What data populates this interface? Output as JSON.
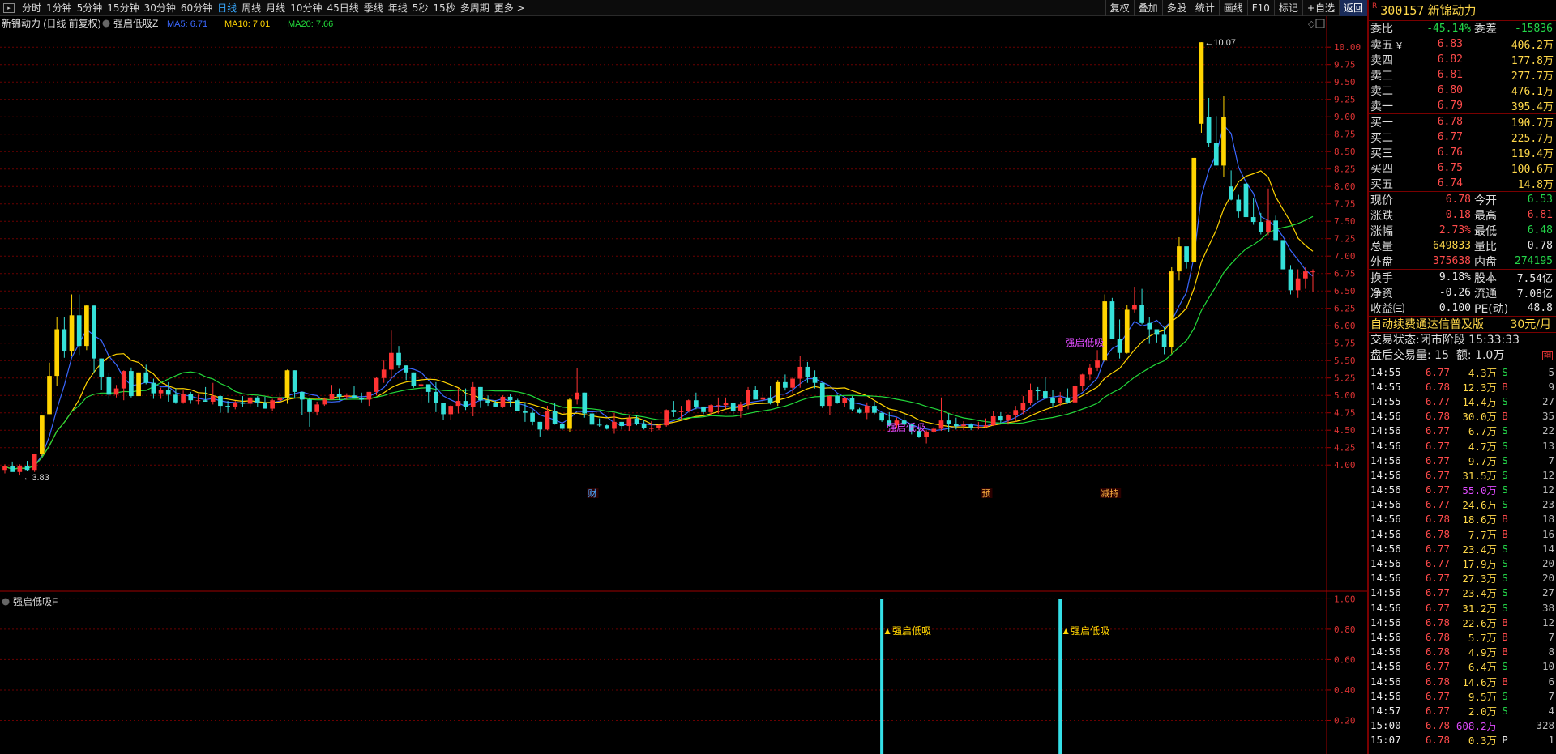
{
  "toolbar": {
    "periods": [
      "分时",
      "1分钟",
      "5分钟",
      "15分钟",
      "30分钟",
      "60分钟",
      "日线",
      "周线",
      "月线",
      "10分钟",
      "45日线",
      "季线",
      "年线",
      "5秒",
      "15秒",
      "多周期",
      "更多 >"
    ],
    "active": "日线",
    "actions": [
      "复权",
      "叠加",
      "多股",
      "统计",
      "画线",
      "F10",
      "标记",
      "+自选",
      "返回"
    ]
  },
  "chart_data": {
    "type": "candlestick",
    "title": "新锦动力 (日线 前复权)",
    "indicator": "强启低吸Z",
    "ma_labels": [
      "MA5: 6.71",
      "MA10: 7.01",
      "MA20: 7.66"
    ],
    "ma_colors": [
      "#3b68ff",
      "#ffd400",
      "#22d83a"
    ],
    "ylim": [
      3.7,
      10.2
    ],
    "yticks": [
      10.0,
      9.75,
      9.5,
      9.25,
      9.0,
      8.75,
      8.5,
      8.25,
      8.0,
      7.75,
      7.5,
      7.25,
      7.0,
      6.75,
      6.5,
      6.25,
      6.0,
      5.75,
      5.5,
      5.25,
      5.0,
      4.75,
      4.5,
      4.25,
      4.0
    ],
    "max_label": "10.07",
    "min_label": "3.83",
    "event_markers": [
      {
        "label": "财",
        "idx": 79
      },
      {
        "label": "预",
        "idx": 132
      },
      {
        "label": "减持",
        "idx": 148
      }
    ],
    "signal_labels": [
      {
        "text": "强启低吸",
        "idx": 142,
        "price": 5.76
      },
      {
        "text": "强启低吸",
        "idx": 118,
        "price": 4.54
      }
    ],
    "candles": [
      [
        3.93,
        4.01,
        3.88,
        3.98
      ],
      [
        3.98,
        4.05,
        3.92,
        3.9
      ],
      [
        3.9,
        4.01,
        3.85,
        3.99
      ],
      [
        3.99,
        4.06,
        3.91,
        3.93
      ],
      [
        3.93,
        4.16,
        3.9,
        4.16
      ],
      [
        4.16,
        4.71,
        4.13,
        4.71
      ],
      [
        4.73,
        5.47,
        4.73,
        5.28
      ],
      [
        5.28,
        6.12,
        5.13,
        5.95
      ],
      [
        5.95,
        6.12,
        5.54,
        5.63
      ],
      [
        5.63,
        6.45,
        5.57,
        6.15
      ],
      [
        6.15,
        6.45,
        5.58,
        5.71
      ],
      [
        5.71,
        6.3,
        5.65,
        6.29
      ],
      [
        6.29,
        6.29,
        5.33,
        5.53
      ],
      [
        5.53,
        5.53,
        5.08,
        5.27
      ],
      [
        5.27,
        5.32,
        4.95,
        5.01
      ],
      [
        5.01,
        5.15,
        4.97,
        5.1
      ],
      [
        5.1,
        5.36,
        4.93,
        5.35
      ],
      [
        5.35,
        5.4,
        4.97,
        4.99
      ],
      [
        4.99,
        5.33,
        4.99,
        5.33
      ],
      [
        5.33,
        5.44,
        5.16,
        5.18
      ],
      [
        5.18,
        5.24,
        4.95,
        5.03
      ],
      [
        5.03,
        5.11,
        4.95,
        5.08
      ],
      [
        5.08,
        5.19,
        4.91,
        5.01
      ],
      [
        5.01,
        5.1,
        4.88,
        4.9
      ],
      [
        4.9,
        5.07,
        4.88,
        5.02
      ],
      [
        5.02,
        5.05,
        4.88,
        4.93
      ],
      [
        4.93,
        5.01,
        4.87,
        4.93
      ],
      [
        4.93,
        5.12,
        4.91,
        4.91
      ],
      [
        4.91,
        5.18,
        4.87,
        4.99
      ],
      [
        4.99,
        5.0,
        4.75,
        4.85
      ],
      [
        4.85,
        4.92,
        4.75,
        4.84
      ],
      [
        4.84,
        4.92,
        4.8,
        4.9
      ],
      [
        4.9,
        4.99,
        4.84,
        4.88
      ],
      [
        4.88,
        4.98,
        4.84,
        4.97
      ],
      [
        4.97,
        4.99,
        4.84,
        4.9
      ],
      [
        4.9,
        4.98,
        4.81,
        4.81
      ],
      [
        4.81,
        4.95,
        4.77,
        4.93
      ],
      [
        4.93,
        5.04,
        4.89,
        4.97
      ],
      [
        4.97,
        5.37,
        4.88,
        5.36
      ],
      [
        5.36,
        5.36,
        4.97,
        5.05
      ],
      [
        5.05,
        5.05,
        4.72,
        4.94
      ],
      [
        4.94,
        4.97,
        4.55,
        4.76
      ],
      [
        4.76,
        4.91,
        4.71,
        4.87
      ],
      [
        4.87,
        4.97,
        4.85,
        4.94
      ],
      [
        4.94,
        5.15,
        4.94,
        5.02
      ],
      [
        5.02,
        5.1,
        4.93,
        4.98
      ],
      [
        4.98,
        5.03,
        4.94,
        5.0
      ],
      [
        5.0,
        5.13,
        4.96,
        4.96
      ],
      [
        4.96,
        5.04,
        4.9,
        4.94
      ],
      [
        4.94,
        5.05,
        4.85,
        5.05
      ],
      [
        5.05,
        5.26,
        5.0,
        5.25
      ],
      [
        5.25,
        5.5,
        5.18,
        5.37
      ],
      [
        5.37,
        5.93,
        5.24,
        5.61
      ],
      [
        5.61,
        5.71,
        5.39,
        5.43
      ],
      [
        5.43,
        5.43,
        5.22,
        5.33
      ],
      [
        5.33,
        5.33,
        5.11,
        5.13
      ],
      [
        5.13,
        5.2,
        4.88,
        5.16
      ],
      [
        5.16,
        5.16,
        4.9,
        5.05
      ],
      [
        5.05,
        5.19,
        4.76,
        4.89
      ],
      [
        4.89,
        4.89,
        4.65,
        4.73
      ],
      [
        4.73,
        4.86,
        4.65,
        4.85
      ],
      [
        4.85,
        5.1,
        4.74,
        4.92
      ],
      [
        4.92,
        5.1,
        4.79,
        4.83
      ],
      [
        4.83,
        5.19,
        4.7,
        5.12
      ],
      [
        5.12,
        5.12,
        4.82,
        4.93
      ],
      [
        4.93,
        5.0,
        4.85,
        4.89
      ],
      [
        4.89,
        4.93,
        4.84,
        4.84
      ],
      [
        4.84,
        5.0,
        4.82,
        4.98
      ],
      [
        4.98,
        5.02,
        4.83,
        4.93
      ],
      [
        4.93,
        4.95,
        4.77,
        4.78
      ],
      [
        4.78,
        4.89,
        4.62,
        4.75
      ],
      [
        4.75,
        4.79,
        4.57,
        4.62
      ],
      [
        4.62,
        4.62,
        4.41,
        4.51
      ],
      [
        4.51,
        4.85,
        4.5,
        4.77
      ],
      [
        4.77,
        4.89,
        4.58,
        4.59
      ],
      [
        4.59,
        4.59,
        4.5,
        4.52
      ],
      [
        4.52,
        4.96,
        4.47,
        4.94
      ],
      [
        4.94,
        5.39,
        4.87,
        5.04
      ],
      [
        5.04,
        5.04,
        4.68,
        4.74
      ],
      [
        4.74,
        4.74,
        4.56,
        4.58
      ],
      [
        4.58,
        4.67,
        4.55,
        4.57
      ],
      [
        4.57,
        4.58,
        4.51,
        4.52
      ],
      [
        4.52,
        4.75,
        4.45,
        4.62
      ],
      [
        4.62,
        4.62,
        4.51,
        4.56
      ],
      [
        4.56,
        4.71,
        4.49,
        4.67
      ],
      [
        4.67,
        4.71,
        4.57,
        4.59
      ],
      [
        4.59,
        4.64,
        4.51,
        4.53
      ],
      [
        4.53,
        4.63,
        4.47,
        4.53
      ],
      [
        4.53,
        4.58,
        4.5,
        4.57
      ],
      [
        4.57,
        4.8,
        4.55,
        4.79
      ],
      [
        4.79,
        4.92,
        4.69,
        4.76
      ],
      [
        4.76,
        4.85,
        4.64,
        4.78
      ],
      [
        4.78,
        4.94,
        4.76,
        4.93
      ],
      [
        4.93,
        5.04,
        4.8,
        4.84
      ],
      [
        4.84,
        4.84,
        4.73,
        4.76
      ],
      [
        4.76,
        4.87,
        4.73,
        4.86
      ],
      [
        4.86,
        4.97,
        4.74,
        4.86
      ],
      [
        4.86,
        4.97,
        4.81,
        4.89
      ],
      [
        4.89,
        4.89,
        4.73,
        4.78
      ],
      [
        4.78,
        4.91,
        4.68,
        4.87
      ],
      [
        4.87,
        5.12,
        4.8,
        5.08
      ],
      [
        5.08,
        5.13,
        4.94,
        4.94
      ],
      [
        4.94,
        5.05,
        4.89,
        4.97
      ],
      [
        4.97,
        5.14,
        4.87,
        4.89
      ],
      [
        4.89,
        5.22,
        4.85,
        5.19
      ],
      [
        5.19,
        5.3,
        5.07,
        5.11
      ],
      [
        5.11,
        5.27,
        5.03,
        5.24
      ],
      [
        5.24,
        5.57,
        5.11,
        5.41
      ],
      [
        5.41,
        5.48,
        5.18,
        5.26
      ],
      [
        5.26,
        5.36,
        5.1,
        5.18
      ],
      [
        5.18,
        5.18,
        4.82,
        4.85
      ],
      [
        4.85,
        5.0,
        4.72,
        4.99
      ],
      [
        4.99,
        5.01,
        4.88,
        4.89
      ],
      [
        4.89,
        4.97,
        4.83,
        4.96
      ],
      [
        4.96,
        4.99,
        4.78,
        4.8
      ],
      [
        4.8,
        4.82,
        4.74,
        4.75
      ],
      [
        4.75,
        4.9,
        4.66,
        4.85
      ],
      [
        4.85,
        4.91,
        4.73,
        4.75
      ],
      [
        4.75,
        4.75,
        4.62,
        4.64
      ],
      [
        4.64,
        4.76,
        4.55,
        4.57
      ],
      [
        4.57,
        4.68,
        4.53,
        4.64
      ],
      [
        4.64,
        4.74,
        4.55,
        4.58
      ],
      [
        4.58,
        4.6,
        4.44,
        4.49
      ],
      [
        4.49,
        4.53,
        4.39,
        4.4
      ],
      [
        4.4,
        4.5,
        4.31,
        4.48
      ],
      [
        4.48,
        4.55,
        4.46,
        4.52
      ],
      [
        4.52,
        4.97,
        4.49,
        4.64
      ],
      [
        4.64,
        4.74,
        4.47,
        4.59
      ],
      [
        4.59,
        4.68,
        4.51,
        4.56
      ],
      [
        4.56,
        4.63,
        4.5,
        4.58
      ],
      [
        4.58,
        4.6,
        4.5,
        4.54
      ],
      [
        4.54,
        4.62,
        4.51,
        4.55
      ],
      [
        4.55,
        4.67,
        4.54,
        4.57
      ],
      [
        4.57,
        4.77,
        4.56,
        4.7
      ],
      [
        4.7,
        4.76,
        4.6,
        4.64
      ],
      [
        4.64,
        4.73,
        4.58,
        4.72
      ],
      [
        4.72,
        4.85,
        4.62,
        4.79
      ],
      [
        4.79,
        4.99,
        4.73,
        4.89
      ],
      [
        4.89,
        5.17,
        4.86,
        5.08
      ],
      [
        5.08,
        5.12,
        4.93,
        5.06
      ],
      [
        5.06,
        5.27,
        4.95,
        4.96
      ],
      [
        4.96,
        5.08,
        4.84,
        4.89
      ],
      [
        4.89,
        5.05,
        4.85,
        4.97
      ],
      [
        4.97,
        5.1,
        4.88,
        4.9
      ],
      [
        4.9,
        5.17,
        4.89,
        5.14
      ],
      [
        5.14,
        5.31,
        5.06,
        5.3
      ],
      [
        5.3,
        5.45,
        5.22,
        5.4
      ],
      [
        5.4,
        5.65,
        5.35,
        5.5
      ],
      [
        5.5,
        6.45,
        5.48,
        6.35
      ],
      [
        6.35,
        6.4,
        5.82,
        5.81
      ],
      [
        5.81,
        6.09,
        5.53,
        5.61
      ],
      [
        5.61,
        6.3,
        5.6,
        6.23
      ],
      [
        6.23,
        6.56,
        6.19,
        6.3
      ],
      [
        6.3,
        6.53,
        6.02,
        6.04
      ],
      [
        6.04,
        6.13,
        5.74,
        5.95
      ],
      [
        5.95,
        5.95,
        5.76,
        5.87
      ],
      [
        5.87,
        5.98,
        5.59,
        5.69
      ],
      [
        5.69,
        6.84,
        5.6,
        6.78
      ],
      [
        6.78,
        7.27,
        6.65,
        7.14
      ],
      [
        7.14,
        7.07,
        6.82,
        6.92
      ],
      [
        6.92,
        8.41,
        6.93,
        8.41
      ],
      [
        8.9,
        10.07,
        8.77,
        10.07
      ],
      [
        9.0,
        9.27,
        8.57,
        8.62
      ],
      [
        8.62,
        9.01,
        8.45,
        8.3
      ],
      [
        8.3,
        9.3,
        8.13,
        9.0
      ],
      [
        8.0,
        8.23,
        7.8,
        7.81
      ],
      [
        7.81,
        7.88,
        7.55,
        7.64
      ],
      [
        8.04,
        8.04,
        7.54,
        7.56
      ],
      [
        7.56,
        7.83,
        7.45,
        7.49
      ],
      [
        7.49,
        7.62,
        7.31,
        7.34
      ],
      [
        7.34,
        7.97,
        7.3,
        7.51
      ],
      [
        7.51,
        7.58,
        7.26,
        7.23
      ],
      [
        7.23,
        7.22,
        6.81,
        6.81
      ],
      [
        6.81,
        6.87,
        6.45,
        6.51
      ],
      [
        6.51,
        6.81,
        6.4,
        6.68
      ],
      [
        6.68,
        6.84,
        6.53,
        6.78
      ],
      [
        6.78,
        6.81,
        6.48,
        6.78
      ]
    ],
    "ma5_end": 6.71,
    "ma10_end": 7.01,
    "ma20_end": 7.66,
    "sub_indicator": {
      "name": "强启低吸F",
      "yticks": [
        1.0,
        0.8,
        0.6,
        0.4,
        0.2
      ],
      "ylim": [
        0,
        1.05
      ],
      "signals": [
        {
          "idx": 118,
          "value": 1.0,
          "label": "▲强启低吸"
        },
        {
          "idx": 142,
          "value": 1.0,
          "label": "▲强启低吸"
        }
      ]
    }
  },
  "sidebar": {
    "code": "300157",
    "name": "新锦动力",
    "right_mark": "R",
    "webi": {
      "l1": "委比",
      "v1": "-45.14%",
      "l2": "委差",
      "v2": "-15836"
    },
    "sells": [
      {
        "label": "卖五",
        "sub": "￥",
        "price": "6.83",
        "vol": "406.2万"
      },
      {
        "label": "卖四",
        "price": "6.82",
        "vol": "177.8万"
      },
      {
        "label": "卖三",
        "price": "6.81",
        "vol": "277.7万"
      },
      {
        "label": "卖二",
        "price": "6.80",
        "vol": "476.1万"
      },
      {
        "label": "卖一",
        "price": "6.79",
        "vol": "395.4万"
      }
    ],
    "buys": [
      {
        "label": "买一",
        "price": "6.78",
        "vol": "190.7万"
      },
      {
        "label": "买二",
        "price": "6.77",
        "vol": "225.7万"
      },
      {
        "label": "买三",
        "price": "6.76",
        "vol": "119.4万"
      },
      {
        "label": "买四",
        "price": "6.75",
        "vol": "100.6万"
      },
      {
        "label": "买五",
        "price": "6.74",
        "vol": "14.8万"
      }
    ],
    "quote": [
      {
        "l1": "现价",
        "v1": "6.78",
        "l2": "今开",
        "v2": "6.53"
      },
      {
        "l1": "涨跌",
        "v1": "0.18",
        "l2": "最高",
        "v2": "6.81"
      },
      {
        "l1": "涨幅",
        "v1": "2.73%",
        "l2": "最低",
        "v2": "6.48"
      },
      {
        "l1": "总量",
        "v1": "649833",
        "l2": "量比",
        "v2": "0.78"
      },
      {
        "l1": "外盘",
        "v1": "375638",
        "l2": "内盘",
        "v2": "274195"
      }
    ],
    "fund": [
      {
        "l1": "换手",
        "v1": "9.18%",
        "l2": "股本",
        "v2": "7.54亿"
      },
      {
        "l1": "净资",
        "v1": "-0.26",
        "l2": "流通",
        "v2": "7.08亿"
      },
      {
        "l1": "收益㈢",
        "v1": "0.100",
        "l2": "PE(动)",
        "v2": "48.8"
      }
    ],
    "ad": {
      "text": "自动续费通达信普及版",
      "price": "30元/月"
    },
    "status": {
      "label": "交易状态:",
      "value": "闭市阶段",
      "time": "15:33:33"
    },
    "after": {
      "label": "盘后交易量:",
      "vol": "15",
      "amt_label": "额:",
      "amt": "1.0万"
    },
    "ticks": [
      [
        "14:55",
        "6.77",
        "4.3万",
        "S",
        "5"
      ],
      [
        "14:55",
        "6.78",
        "12.3万",
        "B",
        "9"
      ],
      [
        "14:55",
        "6.77",
        "14.4万",
        "S",
        "27"
      ],
      [
        "14:56",
        "6.78",
        "30.0万",
        "B",
        "35"
      ],
      [
        "14:56",
        "6.77",
        "6.7万",
        "S",
        "22"
      ],
      [
        "14:56",
        "6.77",
        "4.7万",
        "S",
        "13"
      ],
      [
        "14:56",
        "6.77",
        "9.7万",
        "S",
        "7"
      ],
      [
        "14:56",
        "6.77",
        "31.5万",
        "S",
        "12"
      ],
      [
        "14:56",
        "6.77",
        "55.0万",
        "S",
        "12"
      ],
      [
        "14:56",
        "6.77",
        "24.6万",
        "S",
        "23"
      ],
      [
        "14:56",
        "6.78",
        "18.6万",
        "B",
        "18"
      ],
      [
        "14:56",
        "6.78",
        "7.7万",
        "B",
        "16"
      ],
      [
        "14:56",
        "6.77",
        "23.4万",
        "S",
        "14"
      ],
      [
        "14:56",
        "6.77",
        "17.9万",
        "S",
        "20"
      ],
      [
        "14:56",
        "6.77",
        "27.3万",
        "S",
        "20"
      ],
      [
        "14:56",
        "6.77",
        "23.4万",
        "S",
        "27"
      ],
      [
        "14:56",
        "6.77",
        "31.2万",
        "S",
        "38"
      ],
      [
        "14:56",
        "6.78",
        "22.6万",
        "B",
        "12"
      ],
      [
        "14:56",
        "6.78",
        "5.7万",
        "B",
        "7"
      ],
      [
        "14:56",
        "6.78",
        "4.9万",
        "B",
        "8"
      ],
      [
        "14:56",
        "6.77",
        "6.4万",
        "S",
        "10"
      ],
      [
        "14:56",
        "6.78",
        "14.6万",
        "B",
        "6"
      ],
      [
        "14:56",
        "6.77",
        "9.5万",
        "S",
        "7"
      ],
      [
        "14:57",
        "6.77",
        "2.0万",
        "S",
        "4"
      ],
      [
        "15:00",
        "6.78",
        "608.2万",
        "",
        "328"
      ],
      [
        "15:07",
        "6.78",
        "0.3万",
        "P",
        "1"
      ]
    ]
  }
}
